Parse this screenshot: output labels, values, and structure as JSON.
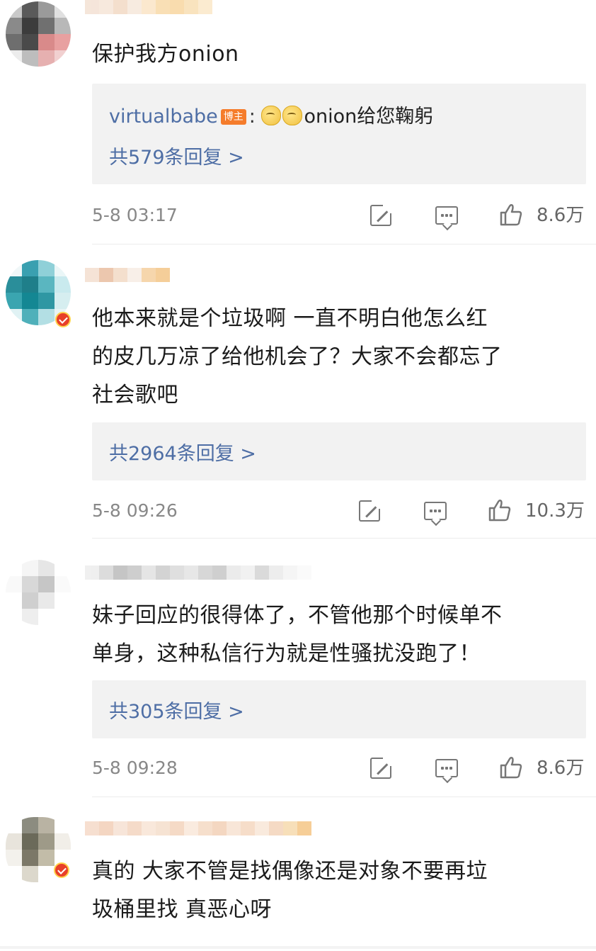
{
  "comments": [
    {
      "text_lines": [
        "保护我方onion"
      ],
      "replies": {
        "author": "virtualbabe",
        "author_badge": "博主",
        "colon": ":",
        "text": "onion给您鞠躬",
        "emoji": "face-emoji",
        "count_label": "共579条回复 >"
      },
      "time": "5-8 03:17",
      "likes": "8.6万",
      "verified": false
    },
    {
      "text_lines": [
        "他本来就是个垃圾啊 一直不明白他怎么红",
        "的皮几万凉了给他机会了？大家不会都忘了",
        "社会歌吧"
      ],
      "replies": {
        "count_label": "共2964条回复 >"
      },
      "time": "5-8 09:26",
      "likes": "10.3万",
      "verified": true
    },
    {
      "text_lines": [
        "妹子回应的很得体了，不管他那个时候单不",
        "单身，这种私信行为就是性骚扰没跑了！"
      ],
      "replies": {
        "count_label": "共305条回复 >"
      },
      "time": "5-8 09:28",
      "likes": "8.6万",
      "verified": false
    },
    {
      "text_lines": [
        "真的 大家不管是找偶像还是对象不要再垃",
        "圾桶里找 真恶心呀"
      ],
      "verified": true
    }
  ],
  "icons": {
    "share": "share-icon",
    "comment": "comment-icon",
    "like": "thumbs-up-icon",
    "verified": "verified-badge-icon"
  },
  "colors": {
    "link": "#4e6ea5",
    "reply_bg": "#f2f2f2",
    "badge_orange": "#f57c2b"
  }
}
